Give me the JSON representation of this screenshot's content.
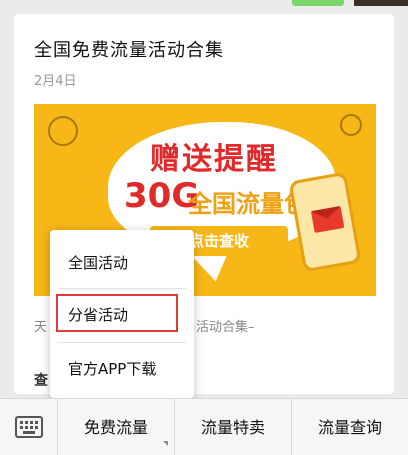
{
  "article": {
    "title": "全国免费流量活动合集",
    "date": "2月4日",
    "snippet_left": "天",
    "snippet_right": "活动合集–",
    "footer_left": "查"
  },
  "banner": {
    "headline": "赠送提醒",
    "amount": "30G",
    "product": "全国流量包",
    "button": "点击查收",
    "colors": {
      "background": "#f7b717",
      "headline": "#e02a2a"
    }
  },
  "popup": {
    "items": [
      {
        "label": "全国活动"
      },
      {
        "label": "分省活动",
        "highlighted": true
      },
      {
        "label": "官方APP下载"
      }
    ],
    "highlight_color": "#e03a3a"
  },
  "menu": {
    "keyboard_icon": "keyboard-icon",
    "tabs": [
      {
        "label": "免费流量",
        "has_submenu": true
      },
      {
        "label": "流量特卖",
        "has_submenu": false
      },
      {
        "label": "流量查询",
        "has_submenu": false
      }
    ]
  }
}
